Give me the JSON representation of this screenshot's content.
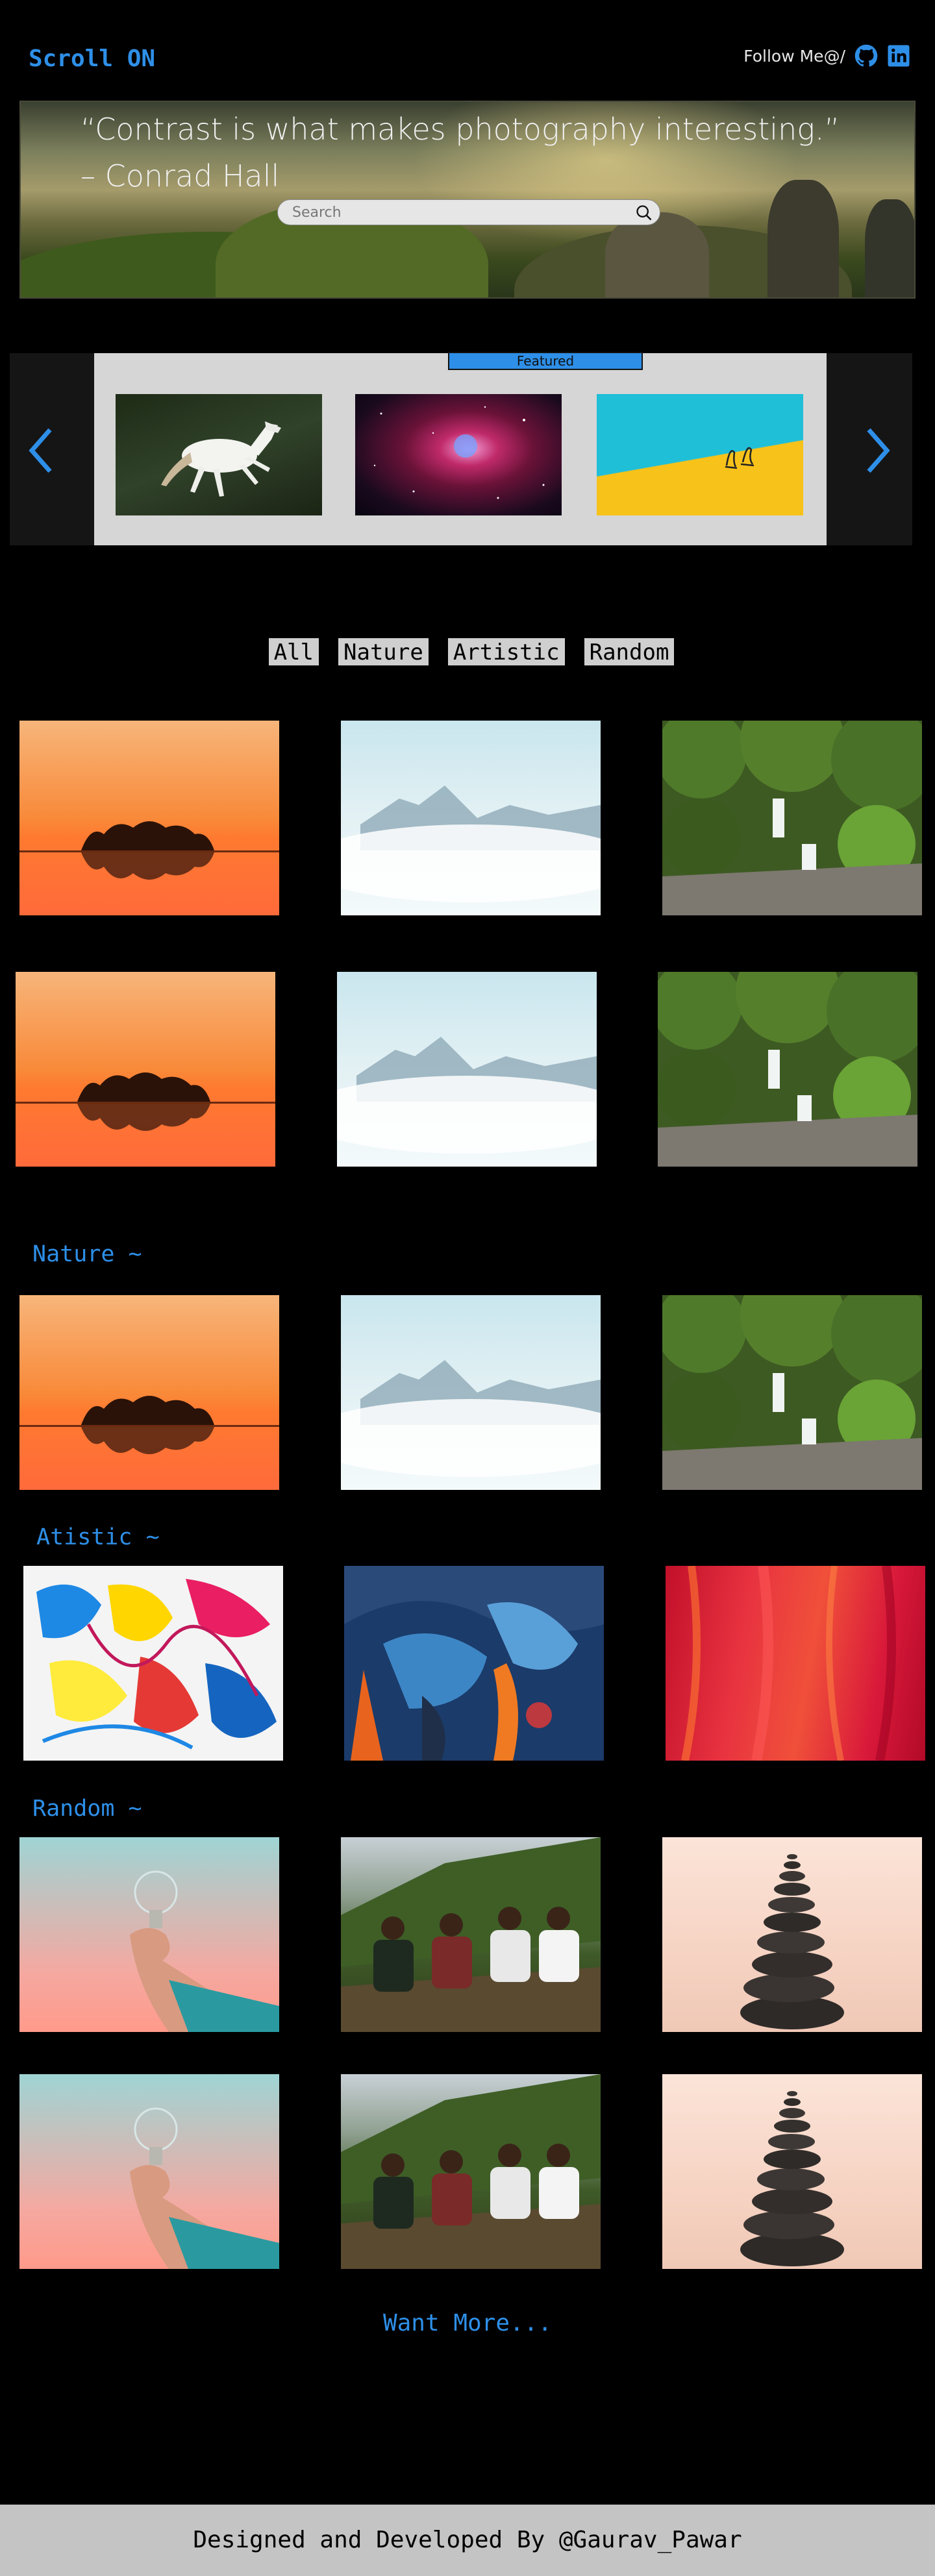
{
  "header": {
    "brand": "Scroll ON",
    "follow_text": "Follow Me@/",
    "icons": [
      "github-icon",
      "linkedin-icon"
    ],
    "accent_color": "#2e8fe8"
  },
  "hero": {
    "quote_line1": "“Contrast is what makes photography interesting.”",
    "quote_line2": "– Conrad Hall",
    "search_placeholder": "Search"
  },
  "carousel": {
    "badge": "Featured",
    "thumbnails": [
      "white-horse",
      "red-nebula",
      "yellow-cyan-minimal"
    ]
  },
  "filters": [
    "All",
    "Nature",
    "Artistic",
    "Random"
  ],
  "sections": {
    "nature": "Nature ~",
    "artistic": "Atistic ~",
    "random": "Random ~"
  },
  "want_more": "Want More...",
  "footer": "Designed and Developed By @Gaurav_Pawar"
}
